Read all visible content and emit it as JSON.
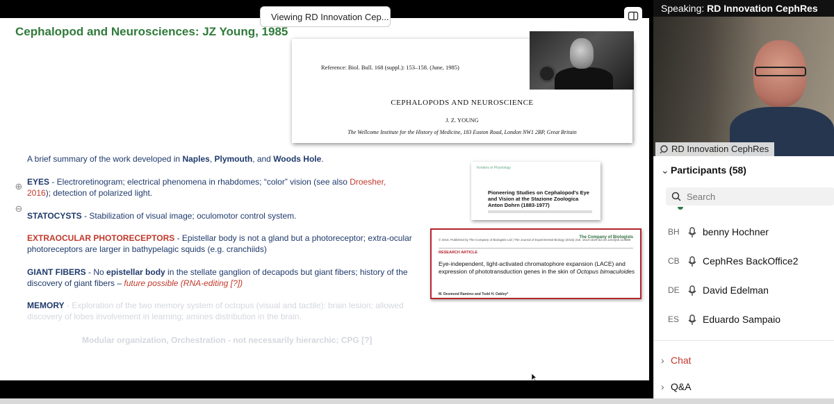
{
  "header": {
    "viewing_label": "Viewing RD Innovation Cep..."
  },
  "slide": {
    "title": "Cephalopod and Neurosciences: JZ Young, 1985",
    "paper": {
      "reference": "Reference: Biol. Bull. 168 (suppl.): 153–158. (June, 1985)",
      "title": "CEPHALOPODS AND NEUROSCIENCE",
      "author": "J. Z. YOUNG",
      "institute": "The Wellcome Institute for the History of Medicine, 183 Euston Road, London NW1 2BP, Great Britain"
    },
    "intro": {
      "a": "A brief summary of the work developed in ",
      "naples": "Naples",
      "comma1": ", ",
      "plymouth": "Plymouth",
      "and": ", and ",
      "woods": "Woods Hole",
      "end": "."
    },
    "eyes": {
      "key": "EYES",
      "text": " - Electroretinogram; electrical phenomena in rhabdomes; “color” vision (see also ",
      "ref": "Droesher, 2016",
      "end": "); detection of polarized light."
    },
    "statocysts": {
      "key": "STATOCYSTS",
      "text": " - Stabilization of visual image; oculomotor control system."
    },
    "extraocular": {
      "key": "EXTRAOCULAR PHOTORECEPTORS",
      "text": " - Epistellar body is not a gland but a photoreceptor; extra-ocular photoreceptors are larger in bathypelagic squids (e.g. cranchiids)"
    },
    "giant": {
      "key": "GIANT FIBERS",
      "a": " - No ",
      "epistellar": "epistellar body",
      "b": " in the stellate ganglion of decapods but giant fibers; history of the discovery of giant fibers – ",
      "future": "future possible (RNA-editing [?])"
    },
    "memory": {
      "key": "MEMORY",
      "text": " - Exploration of the two memory system of octopus (visual and tactile): brain lesion; allowed discovery of lobes involvement in learning; amines distribution in the brain."
    },
    "modular": "Modular organization, Orchestration - not necessarily hierarchic; CPG [?]",
    "card_frontiers": {
      "logo": "frontiers in Physiology",
      "title": "Pioneering Studies on Cephalopod's Eye and Vision at the Stazione Zoologica Anton Dohrn (1883-1977)"
    },
    "card_jeb": {
      "header": "© 2015. Published by The Company of Biologists Ltd | The Journal of Experimental Biology (2015) 218, 1513-1520 doi:10.1242/jeb.113688",
      "publisher": "The Company of Biologists",
      "kind": "RESEARCH ARTICLE",
      "title": "Eye-independent, light-activated chromatophore expansion (LACE) and expression of phototransduction genes in the skin of",
      "species": "Octopus bimaculoides",
      "authors": "M. Desmond Ramirez and Todd H. Oakley*"
    }
  },
  "speaker": {
    "speaking_label": "Speaking:",
    "speaking_name": "RD Innovation CephRes",
    "video_label": "RD Innovation CephRes"
  },
  "participants": {
    "header": "Participants (58)",
    "search_placeholder": "Search",
    "list": [
      {
        "initials": "BH",
        "name": "benny Hochner"
      },
      {
        "initials": "CB",
        "name": "CephRes BackOffice2"
      },
      {
        "initials": "DE",
        "name": "David Edelman"
      },
      {
        "initials": "ES",
        "name": "Eduardo Sampaio"
      }
    ]
  },
  "sections": {
    "chat": "Chat",
    "qa": "Q&A"
  },
  "colors": {
    "title_green": "#2f7a3a",
    "text_navy": "#1f3a6b",
    "accent_red": "#c0392b"
  }
}
